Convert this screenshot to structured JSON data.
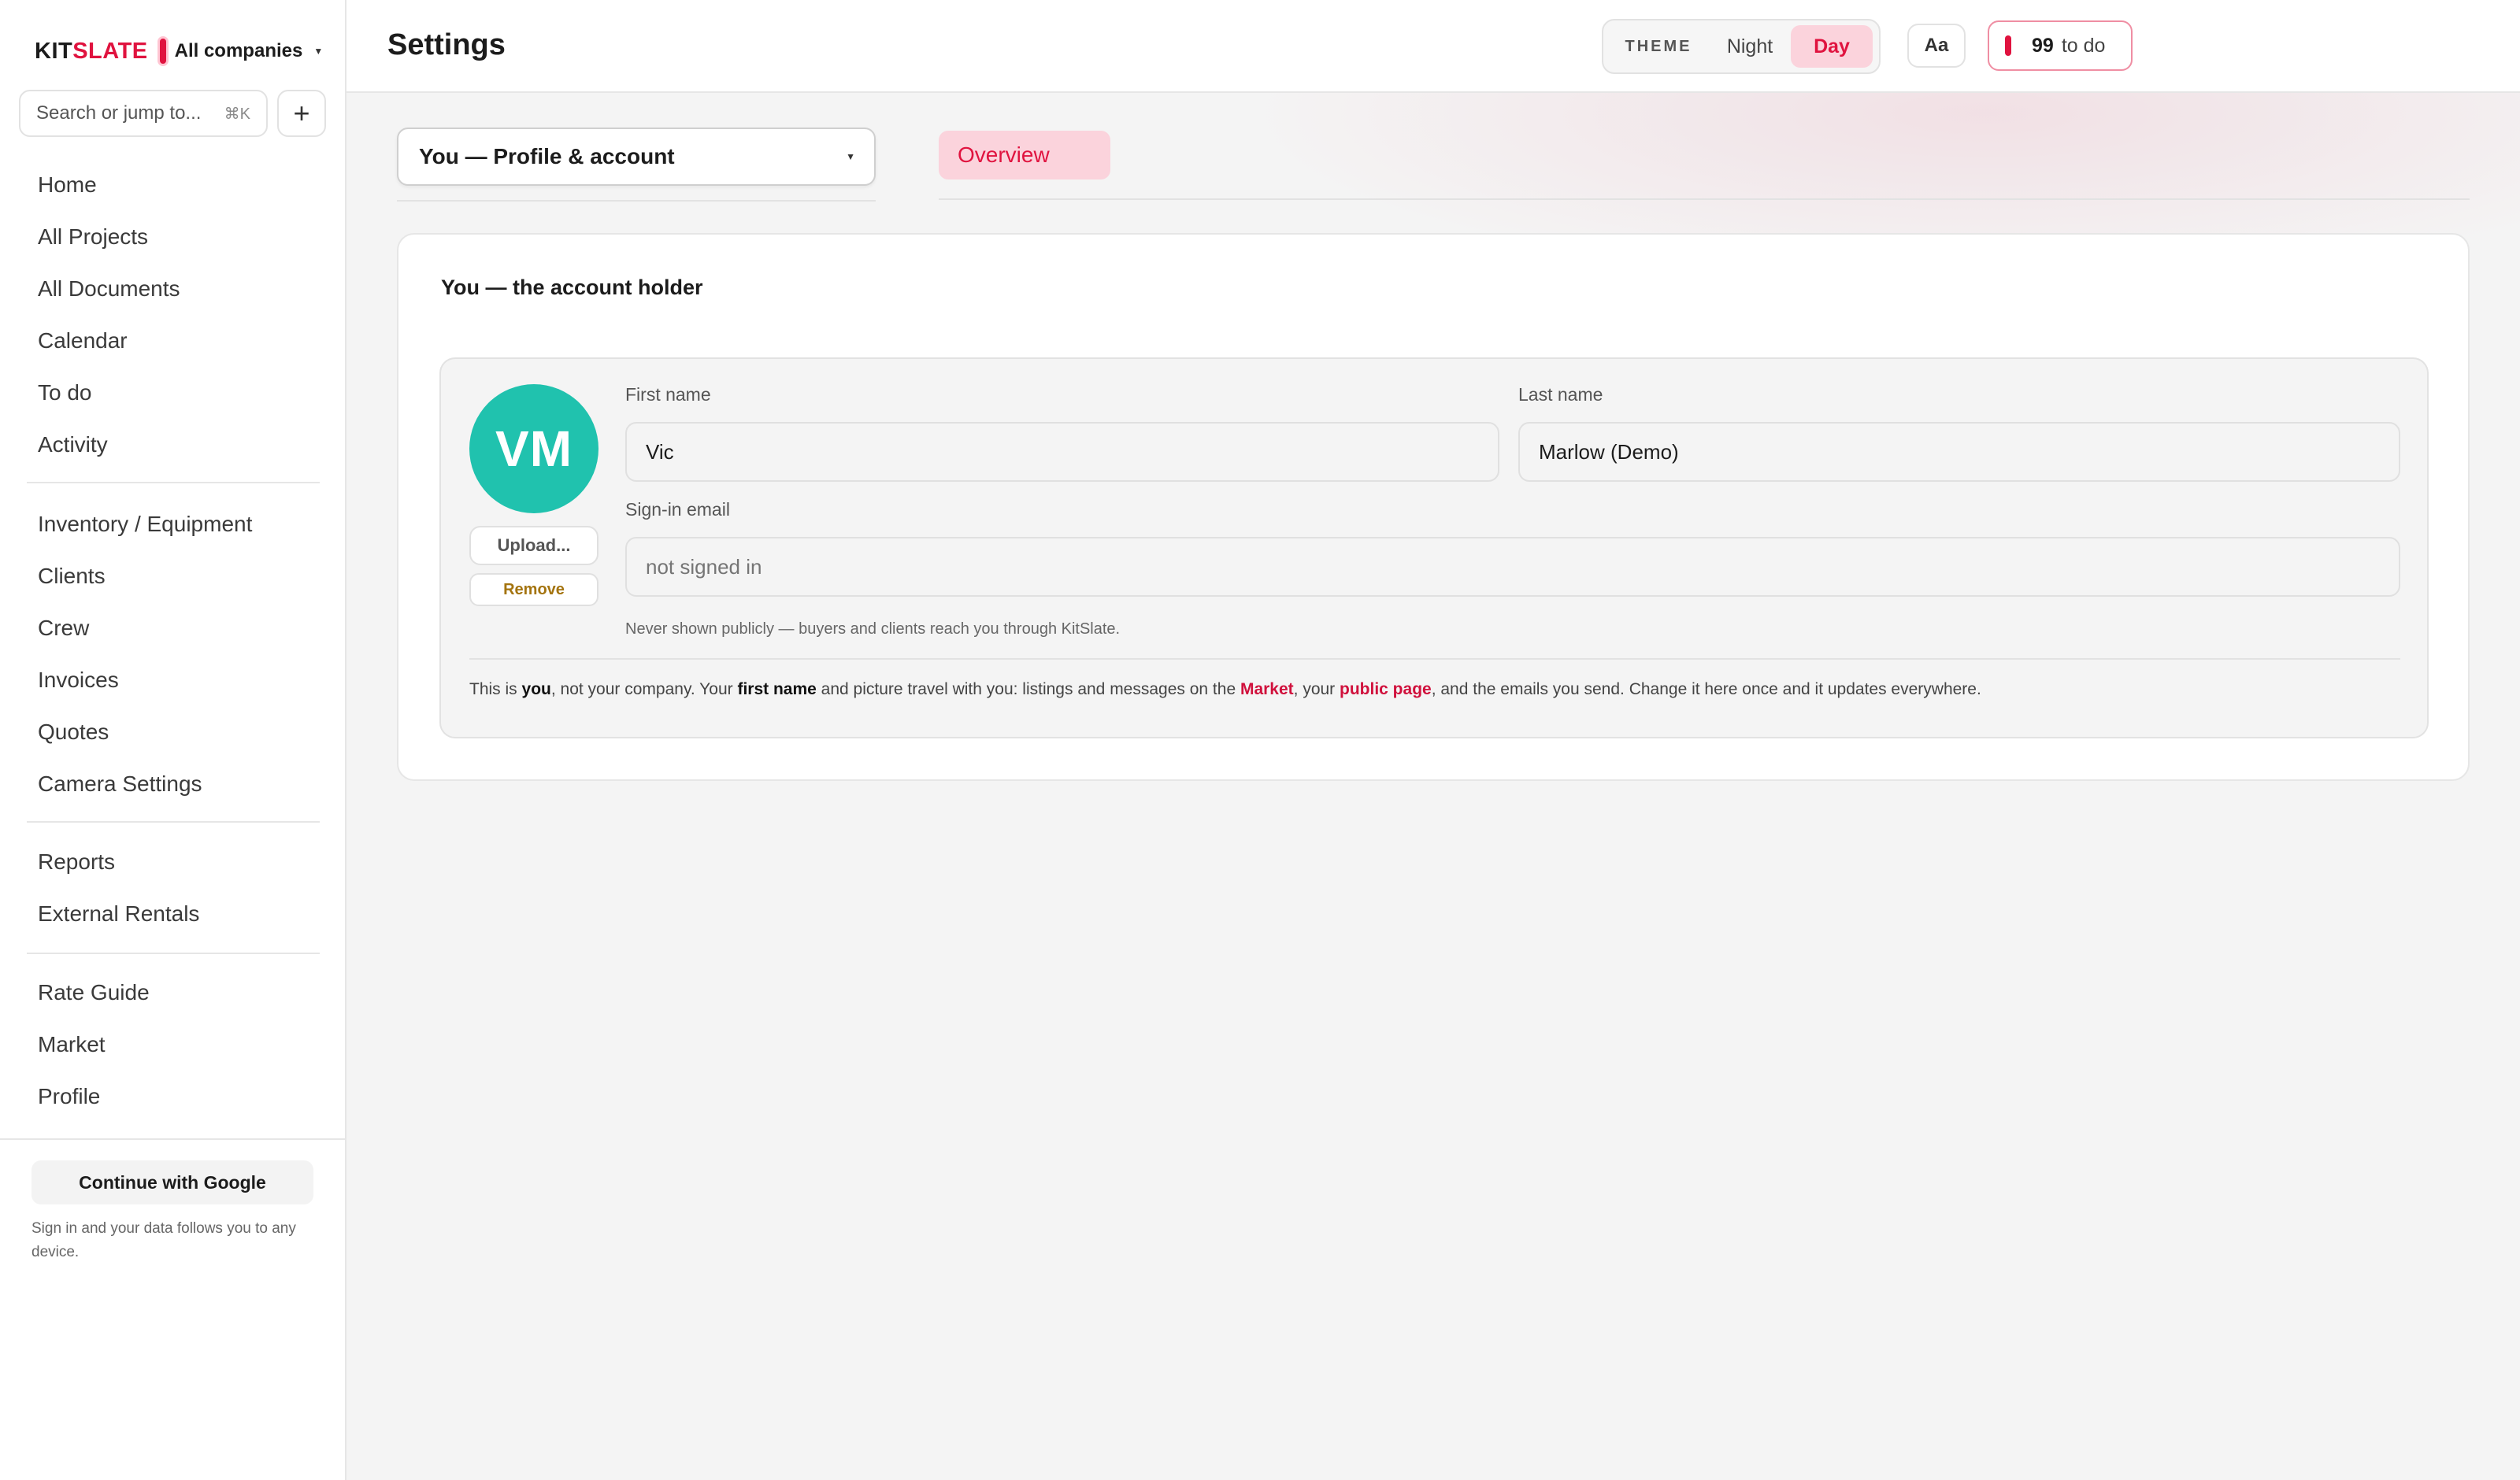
{
  "brand": {
    "kit": "KIT",
    "slate": "SLATE",
    "company": "All companies"
  },
  "search": {
    "placeholder": "Search or jump to...",
    "shortcut": "⌘K",
    "add_label": "+"
  },
  "nav": {
    "group1": [
      "Home",
      "All Projects",
      "All Documents",
      "Calendar",
      "To do",
      "Activity"
    ],
    "group2": [
      "Inventory / Equipment",
      "Clients",
      "Crew",
      "Invoices",
      "Quotes",
      "Camera Settings"
    ],
    "group3": [
      "Reports",
      "External Rentals"
    ],
    "group4": [
      "Rate Guide",
      "Market",
      "Profile"
    ]
  },
  "sidebar_footer": {
    "google_label": "Continue with Google",
    "note": "Sign in and your data follows you to any device."
  },
  "header": {
    "title": "Settings",
    "theme_label": "THEME",
    "theme_night": "Night",
    "theme_day": "Day",
    "font_button": "Aa",
    "todo_count": "99",
    "todo_label": "to do"
  },
  "section": {
    "selected": "You — Profile & account",
    "tab": "Overview"
  },
  "card": {
    "title": "You — the account holder",
    "initials": "VM",
    "upload_label": "Upload...",
    "remove_label": "Remove",
    "first_name_label": "First name",
    "first_name_value": "Vic",
    "last_name_label": "Last name",
    "last_name_value": "Marlow (Demo)",
    "email_label": "Sign-in email",
    "email_placeholder": "not signed in",
    "email_note": "Never shown publicly — buyers and clients reach you through KitSlate.",
    "info": {
      "p1": "This is ",
      "you": "you",
      "p2": ", not your company. Your ",
      "first_name": "first name",
      "p3": " and picture travel with you: listings and messages on the ",
      "market": "Market",
      "p4": ", your ",
      "public_page": "public page",
      "p5": ", and the emails you send. Change it here once and it updates everywhere."
    }
  },
  "colors": {
    "accent": "#e0133f",
    "avatar": "#20c2ae",
    "accent_soft": "#fbd3dc",
    "remove": "#a4740f"
  }
}
